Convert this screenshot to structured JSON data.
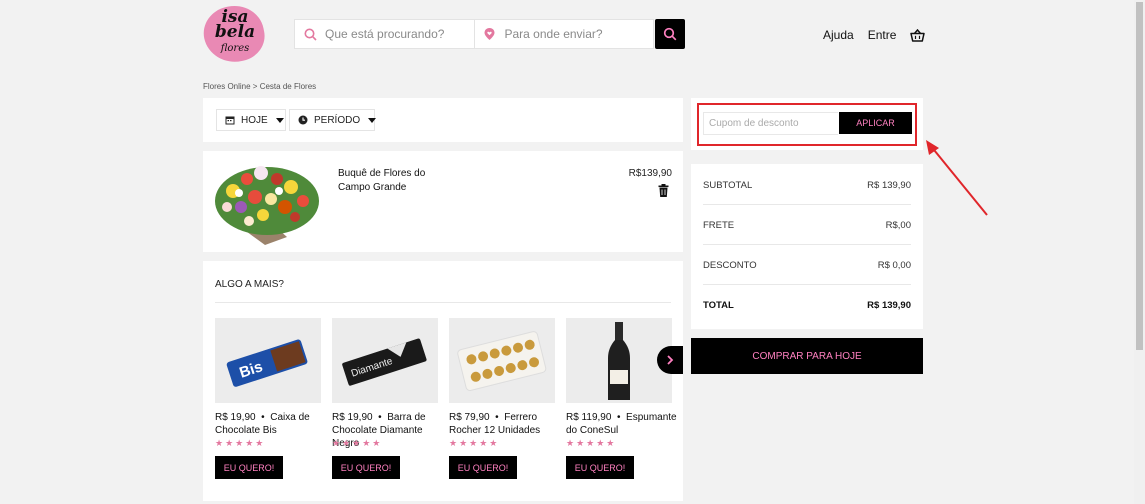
{
  "header": {
    "logo_text": [
      "isa",
      "bela",
      "flores"
    ],
    "search_placeholder": "Que está procurando?",
    "location_placeholder": "Para onde enviar?",
    "nav_help": "Ajuda",
    "nav_login": "Entre"
  },
  "breadcrumb": [
    "Flores Online",
    "Cesta de Flores"
  ],
  "delivery": {
    "date_label": "HOJE",
    "period_label": "PERÍODO"
  },
  "cart_item": {
    "name": "Buquê de Flores do Campo Grande",
    "price": "R$139,90"
  },
  "more": {
    "title": "ALGO A MAIS?",
    "buy_label": "EU QUERO!",
    "products": [
      {
        "price": "R$ 19,90",
        "name": "Caixa de Chocolate Bis",
        "stars": "★★★★★"
      },
      {
        "price": "R$ 19,90",
        "name": "Barra de Chocolate Diamante Negro",
        "stars": "★★★★★"
      },
      {
        "price": "R$ 79,90",
        "name": "Ferrero Rocher 12 Unidades",
        "stars": "★★★★★"
      },
      {
        "price": "R$ 119,90",
        "name": "Espumante do ConeSul",
        "stars": "★★★★★"
      }
    ]
  },
  "coupon": {
    "placeholder": "Cupom de desconto",
    "apply_label": "APLICAR"
  },
  "summary": {
    "subtotal_label": "SUBTOTAL",
    "subtotal_value": "R$ 139,90",
    "shipping_label": "FRETE",
    "shipping_value": "R$,00",
    "discount_label": "DESCONTO",
    "discount_value": "R$ 0,00",
    "total_label": "TOTAL",
    "total_value": "R$ 139,90"
  },
  "checkout_label": "COMPRAR PARA HOJE",
  "colors": {
    "accent_pink": "#ff80c0",
    "annotation_red": "#e0262b"
  }
}
